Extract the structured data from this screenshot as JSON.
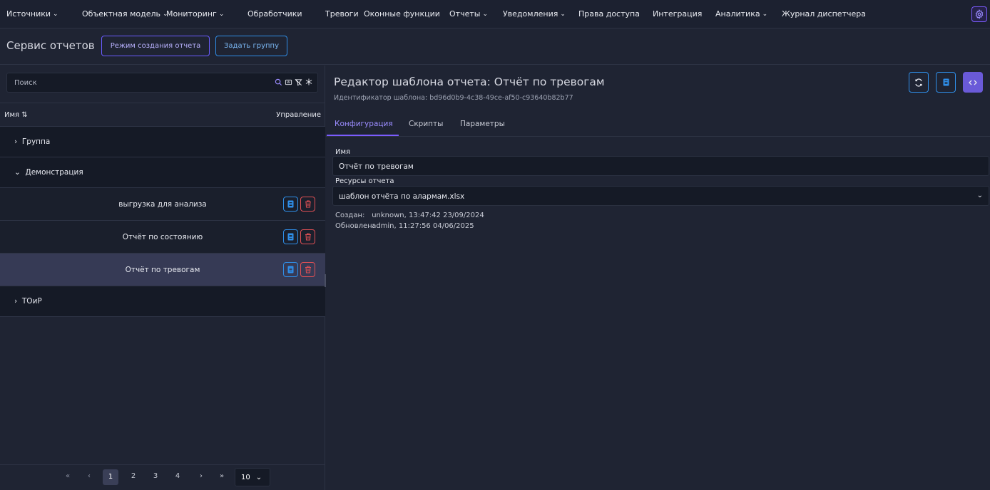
{
  "topnav": {
    "items": [
      {
        "label": "Источники",
        "chevron": true
      },
      {
        "label": "Объектная модель",
        "chevron": true
      },
      {
        "label": "Мониторинг",
        "chevron": true
      },
      {
        "label": "Обработчики",
        "chevron": false
      },
      {
        "label": "Тревоги",
        "chevron": false
      },
      {
        "label": "Оконные функции",
        "chevron": false
      },
      {
        "label": "Отчеты",
        "chevron": true
      },
      {
        "label": "Уведомления",
        "chevron": true
      },
      {
        "label": "Права доступа",
        "chevron": false
      },
      {
        "label": "Интеграция",
        "chevron": false
      },
      {
        "label": "Аналитика",
        "chevron": true
      },
      {
        "label": "Журнал диспетчера",
        "chevron": false
      }
    ],
    "settings_icon": "gear-icon"
  },
  "header": {
    "title": "Сервис отчетов",
    "create_mode_label": "Режим создания отчета",
    "set_group_label": "Задать группу"
  },
  "sidebar": {
    "search_placeholder": "Поиск",
    "col_name": "Имя",
    "col_control": "Управление",
    "groups": [
      {
        "label": "Группа",
        "expanded": false
      },
      {
        "label": "Демонстрация",
        "expanded": true
      },
      {
        "label": "ТОиР",
        "expanded": false
      }
    ],
    "reports": [
      {
        "name": "выгрузка для анализа",
        "selected": false
      },
      {
        "name": "Отчёт по состоянию",
        "selected": false
      },
      {
        "name": "Отчёт по тревогам",
        "selected": true
      }
    ],
    "pager": {
      "first": "«",
      "prev": "‹",
      "pages": [
        "1",
        "2",
        "3",
        "4"
      ],
      "current": "1",
      "next": "›",
      "last": "»",
      "page_size": "10"
    }
  },
  "editor": {
    "title": "Редактор шаблона отчета: Отчёт по тревогам",
    "template_id_label": "Идентификатор шаблона:",
    "template_id": "bd96d0b9-4c38-49ce-af50-c93640b82b77",
    "tabs": [
      "Конфигурация",
      "Скрипты",
      "Параметры"
    ],
    "active_tab": "Конфигурация",
    "name_label": "Имя",
    "name_value": "Отчёт по тревогам",
    "resources_label": "Ресурсы отчета",
    "resources_value": "шаблон отчёта по алармам.xlsx",
    "created_label": "Создан:",
    "created_value": "unknown, 13:47:42 23/09/2024",
    "updated_label": "Обновлен:",
    "updated_value": "admin, 11:27:56 04/06/2025"
  },
  "colors": {
    "accent": "#7c5cff",
    "info": "#2f8ee8",
    "danger": "#e05055",
    "background": "#1f2433"
  }
}
